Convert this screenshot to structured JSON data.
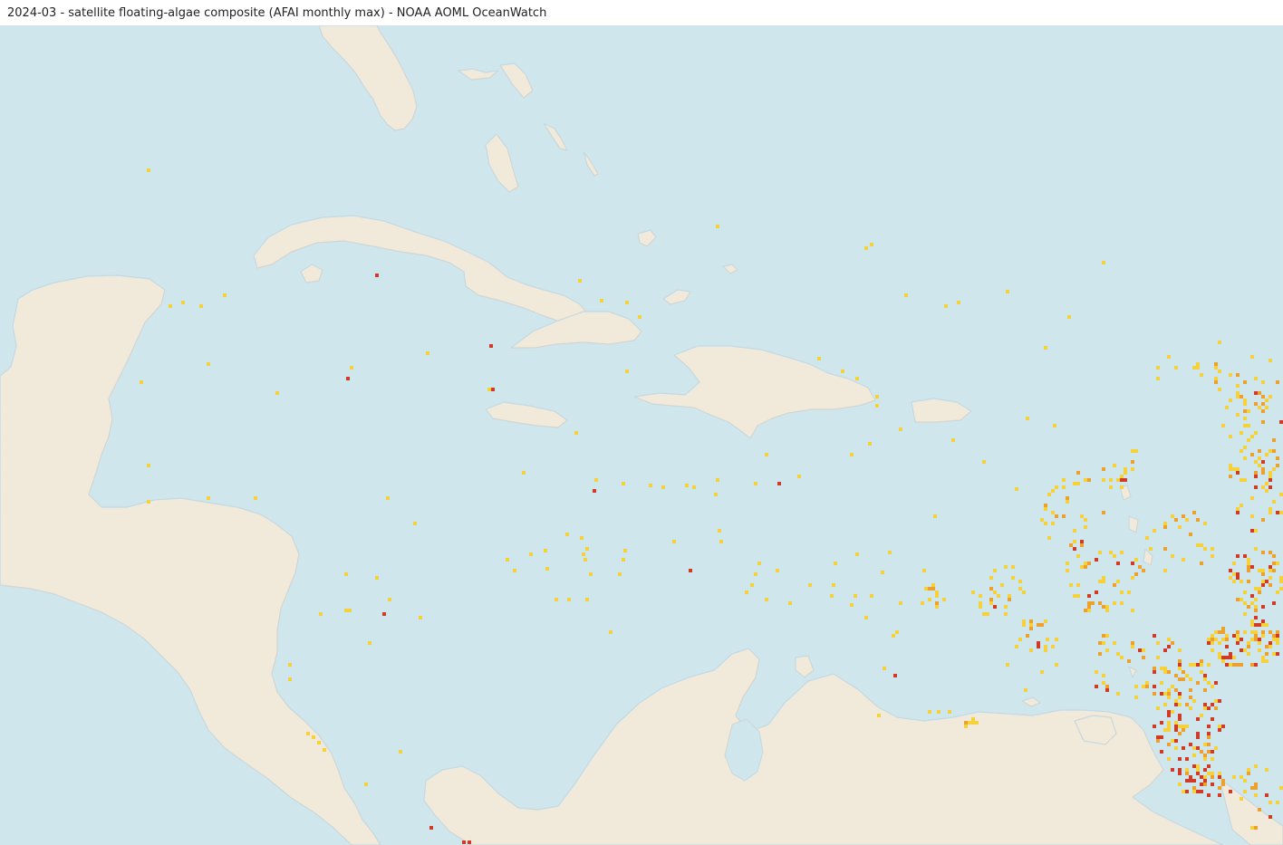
{
  "title": "2024-03 - satellite floating-algae composite (AFAI monthly max) - NOAA AOML OceanWatch",
  "colors": {
    "ocean": "#d0e6ed",
    "land": "#f1e9da",
    "coast": "#c9d8dc",
    "algae_low": "#f6d23a",
    "algae_mid": "#eea02c",
    "algae_high": "#cf3b26"
  }
}
